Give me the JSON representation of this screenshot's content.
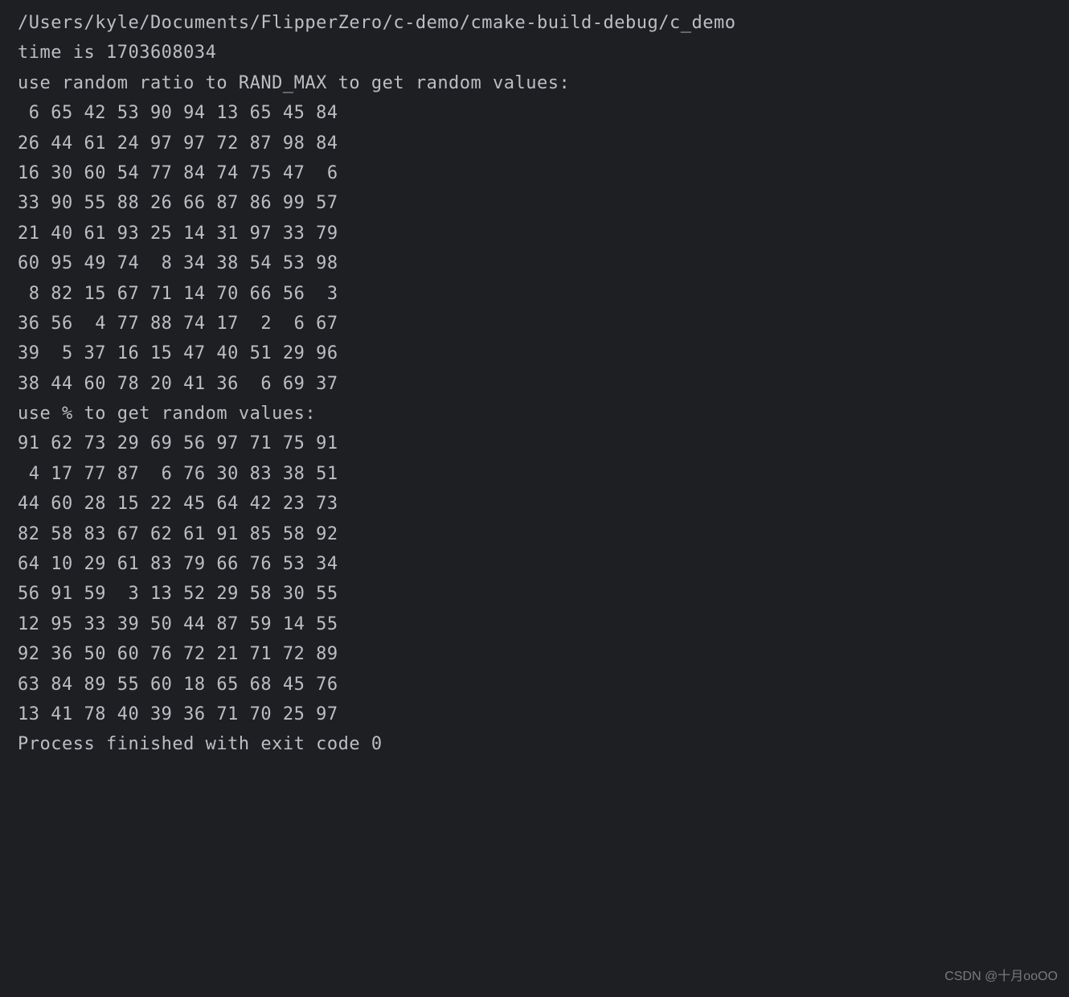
{
  "terminal": {
    "exec_path": "/Users/kyle/Documents/FlipperZero/c-demo/cmake-build-debug/c_demo",
    "time_line": "time is 1703608034",
    "blank1": "",
    "header1": "use random ratio to RAND_MAX to get random values:",
    "grid1": [
      [
        6,
        65,
        42,
        53,
        90,
        94,
        13,
        65,
        45,
        84
      ],
      [
        26,
        44,
        61,
        24,
        97,
        97,
        72,
        87,
        98,
        84
      ],
      [
        16,
        30,
        60,
        54,
        77,
        84,
        74,
        75,
        47,
        6
      ],
      [
        33,
        90,
        55,
        88,
        26,
        66,
        87,
        86,
        99,
        57
      ],
      [
        21,
        40,
        61,
        93,
        25,
        14,
        31,
        97,
        33,
        79
      ],
      [
        60,
        95,
        49,
        74,
        8,
        34,
        38,
        54,
        53,
        98
      ],
      [
        8,
        82,
        15,
        67,
        71,
        14,
        70,
        66,
        56,
        3
      ],
      [
        36,
        56,
        4,
        77,
        88,
        74,
        17,
        2,
        6,
        67
      ],
      [
        39,
        5,
        37,
        16,
        15,
        47,
        40,
        51,
        29,
        96
      ],
      [
        38,
        44,
        60,
        78,
        20,
        41,
        36,
        6,
        69,
        37
      ]
    ],
    "blank2": "",
    "header2": "use % to get random values:",
    "grid2": [
      [
        91,
        62,
        73,
        29,
        69,
        56,
        97,
        71,
        75,
        91
      ],
      [
        4,
        17,
        77,
        87,
        6,
        76,
        30,
        83,
        38,
        51
      ],
      [
        44,
        60,
        28,
        15,
        22,
        45,
        64,
        42,
        23,
        73
      ],
      [
        82,
        58,
        83,
        67,
        62,
        61,
        91,
        85,
        58,
        92
      ],
      [
        64,
        10,
        29,
        61,
        83,
        79,
        66,
        76,
        53,
        34
      ],
      [
        56,
        91,
        59,
        3,
        13,
        52,
        29,
        58,
        30,
        55
      ],
      [
        12,
        95,
        33,
        39,
        50,
        44,
        87,
        59,
        14,
        55
      ],
      [
        92,
        36,
        50,
        60,
        76,
        72,
        21,
        71,
        72,
        89
      ],
      [
        63,
        84,
        89,
        55,
        60,
        18,
        65,
        68,
        45,
        76
      ],
      [
        13,
        41,
        78,
        40,
        39,
        36,
        71,
        70,
        25,
        97
      ]
    ],
    "blank3": "",
    "exit_line": "Process finished with exit code 0"
  },
  "watermark": "CSDN @十月ooOO"
}
